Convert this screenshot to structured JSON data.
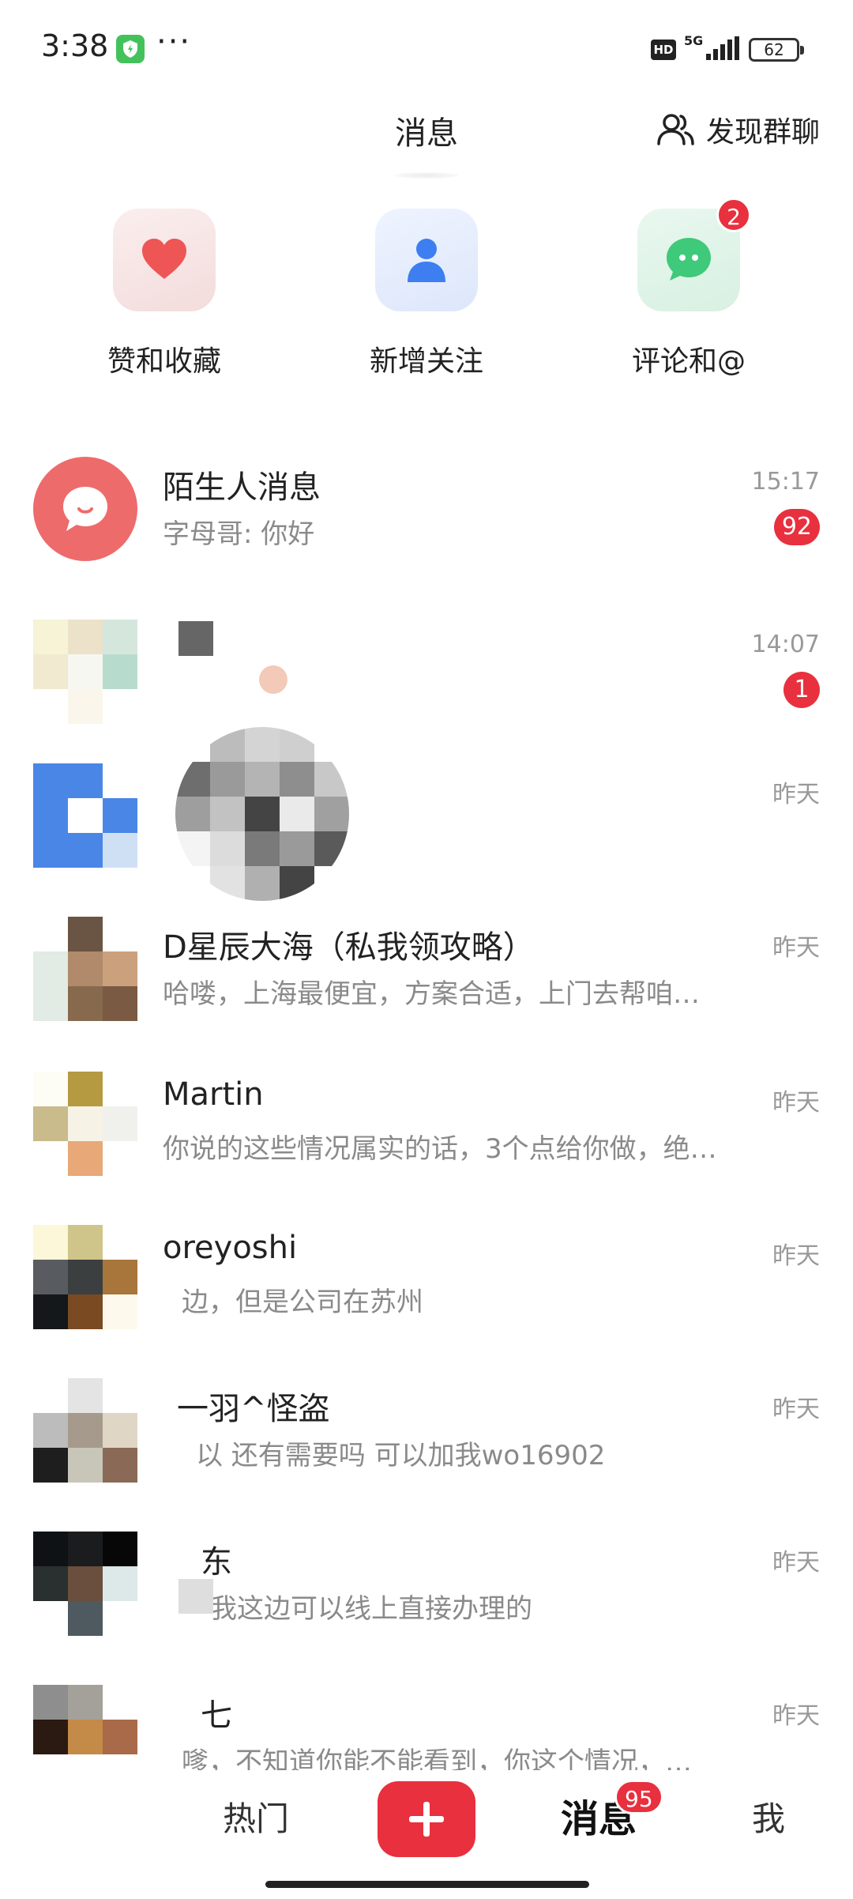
{
  "status_bar": {
    "time": "3:38",
    "dots": "···",
    "hd": "HD",
    "network": "5G",
    "battery": "62"
  },
  "header": {
    "title": "消息",
    "discover_label": "发现群聊"
  },
  "quick_actions": [
    {
      "label": "赞和收藏",
      "icon": "heart-icon",
      "color": "#ee5656"
    },
    {
      "label": "新增关注",
      "icon": "person-icon",
      "color": "#3d7ef0"
    },
    {
      "label": "评论和@",
      "icon": "chat-bubble-icon",
      "color": "#3fc97a",
      "badge": "2"
    }
  ],
  "conversations": [
    {
      "name": "陌生人消息",
      "preview": "字母哥: 你好",
      "time": "15:17",
      "badge": "92"
    },
    {
      "name": "",
      "preview": "",
      "time": "14:07",
      "badge": "1"
    },
    {
      "name": "",
      "preview": "",
      "time": "昨天"
    },
    {
      "name": "D星辰大海（私我领攻略）",
      "preview": "哈喽，上海最便宜，方案合适，上门去帮咱…",
      "time": "昨天"
    },
    {
      "name": "Martin",
      "preview": "你说的这些情况属实的话，3个点给你做，绝…",
      "time": "昨天"
    },
    {
      "name": "oreyoshi",
      "preview": "边，但是公司在苏州",
      "time": "昨天"
    },
    {
      "name": "一羽^怪盗",
      "preview": "以 还有需要吗 可以加我wo16902",
      "time": "昨天"
    },
    {
      "name": "东",
      "preview": "我这边可以线上直接办理的",
      "time": "昨天"
    },
    {
      "name": "七",
      "preview": "嗲，不知道你能不能看到，你这个情况，…",
      "time": "昨天"
    }
  ],
  "tabbar": {
    "hot": "热门",
    "messages": "消息",
    "messages_badge": "95",
    "me": "我"
  },
  "colors": {
    "accent": "#e8303e"
  }
}
